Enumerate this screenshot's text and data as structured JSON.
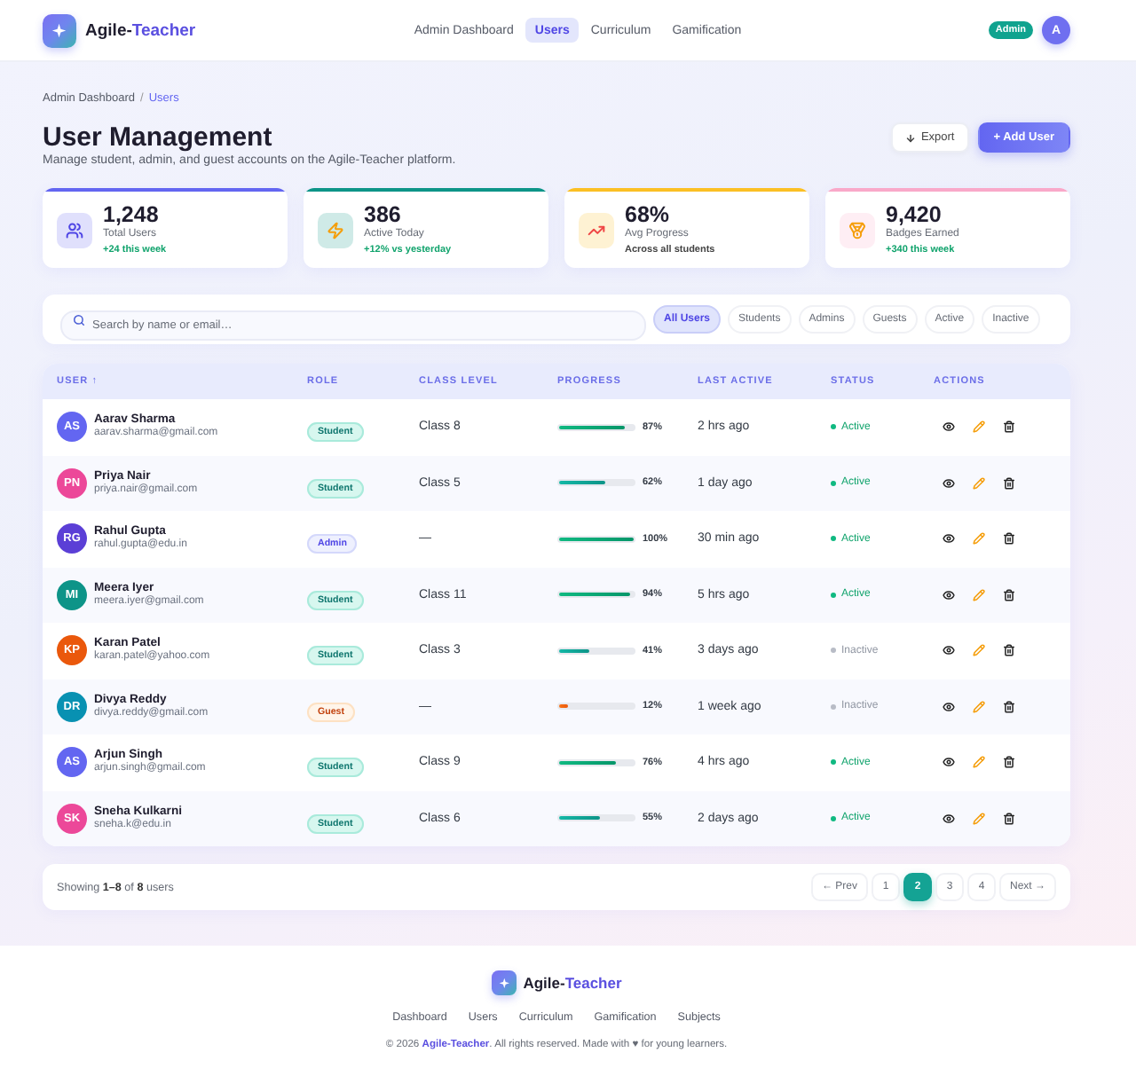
{
  "header": {
    "brand": {
      "prefix": "Agile-",
      "accent": "Teacher"
    },
    "nav": [
      {
        "label": "Admin Dashboard",
        "selected": false
      },
      {
        "label": "Users",
        "selected": true
      },
      {
        "label": "Curriculum",
        "selected": false
      },
      {
        "label": "Gamification",
        "selected": false
      }
    ],
    "role_badge": "Admin",
    "avatar": "A"
  },
  "breadcrumb": {
    "items": [
      {
        "label": "Admin Dashboard",
        "current": false
      },
      {
        "label": "Users",
        "current": true
      }
    ],
    "separator": "/"
  },
  "page": {
    "title": "User Management",
    "subtitle": "Manage student, admin, and guest accounts on the Agile-Teacher platform.",
    "actions": [
      {
        "label": "Export",
        "kind": "secondary"
      },
      {
        "label": "+ Add User",
        "kind": "primary"
      }
    ]
  },
  "stats": [
    {
      "kind": "users",
      "value": "1,248",
      "label": "Total Users",
      "note": "+24 this week",
      "positive": true,
      "color": "#6366f1"
    },
    {
      "kind": "activity",
      "value": "386",
      "label": "Active Today",
      "note": "+12% vs yesterday",
      "positive": true,
      "color": "#0d9488"
    },
    {
      "kind": "progress",
      "value": "68%",
      "label": "Avg Progress",
      "note": "Across all students",
      "positive": false,
      "color": "#fbbf24"
    },
    {
      "kind": "badges",
      "value": "9,420",
      "label": "Badges Earned",
      "note": "+340 this week",
      "positive": true,
      "color": "#f9a8c9"
    }
  ],
  "search": {
    "placeholder": "Search by name or email…"
  },
  "filters": [
    {
      "label": "All Users",
      "selected": true
    },
    {
      "label": "Students",
      "selected": false
    },
    {
      "label": "Admins",
      "selected": false
    },
    {
      "label": "Guests",
      "selected": false
    },
    {
      "label": "Active",
      "selected": false
    },
    {
      "label": "Inactive",
      "selected": false
    }
  ],
  "table": {
    "columns": [
      "USER ↑",
      "ROLE",
      "CLASS LEVEL",
      "PROGRESS",
      "LAST ACTIVE",
      "STATUS",
      "ACTIONS"
    ],
    "rows": [
      {
        "initials": "AS",
        "color": "#6366f1",
        "name": "Aarav Sharma",
        "email": "aarav.sharma@gmail.com",
        "role": {
          "label": "Student",
          "kind": "student"
        },
        "class_level": "Class 8",
        "progress": {
          "level": 0.87,
          "reading": "87%"
        },
        "last_active": "2 hrs ago",
        "status": {
          "label": "Active",
          "active": true
        }
      },
      {
        "initials": "PN",
        "color": "#ec4899",
        "name": "Priya Nair",
        "email": "priya.nair@gmail.com",
        "role": {
          "label": "Student",
          "kind": "student"
        },
        "class_level": "Class 5",
        "progress": {
          "level": 0.62,
          "reading": "62%"
        },
        "last_active": "1 day ago",
        "status": {
          "label": "Active",
          "active": true
        }
      },
      {
        "initials": "RG",
        "color": "#5b3fd6",
        "name": "Rahul Gupta",
        "email": "rahul.gupta@edu.in",
        "role": {
          "label": "Admin",
          "kind": "admin"
        },
        "class_level": "—",
        "progress": {
          "level": 1,
          "reading": "100%"
        },
        "last_active": "30 min ago",
        "status": {
          "label": "Active",
          "active": true
        }
      },
      {
        "initials": "MI",
        "color": "#0d9488",
        "name": "Meera Iyer",
        "email": "meera.iyer@gmail.com",
        "role": {
          "label": "Student",
          "kind": "student"
        },
        "class_level": "Class 11",
        "progress": {
          "level": 0.94,
          "reading": "94%"
        },
        "last_active": "5 hrs ago",
        "status": {
          "label": "Active",
          "active": true
        }
      },
      {
        "initials": "KP",
        "color": "#ea580c",
        "name": "Karan Patel",
        "email": "karan.patel@yahoo.com",
        "role": {
          "label": "Student",
          "kind": "student"
        },
        "class_level": "Class 3",
        "progress": {
          "level": 0.41,
          "reading": "41%"
        },
        "last_active": "3 days ago",
        "status": {
          "label": "Inactive",
          "active": false
        }
      },
      {
        "initials": "DR",
        "color": "#0891b2",
        "name": "Divya Reddy",
        "email": "divya.reddy@gmail.com",
        "role": {
          "label": "Guest",
          "kind": "guest"
        },
        "class_level": "—",
        "progress": {
          "level": 0.12,
          "reading": "12%"
        },
        "last_active": "1 week ago",
        "status": {
          "label": "Inactive",
          "active": false
        }
      },
      {
        "initials": "AS",
        "color": "#6366f1",
        "name": "Arjun Singh",
        "email": "arjun.singh@gmail.com",
        "role": {
          "label": "Student",
          "kind": "student"
        },
        "class_level": "Class 9",
        "progress": {
          "level": 0.76,
          "reading": "76%"
        },
        "last_active": "4 hrs ago",
        "status": {
          "label": "Active",
          "active": true
        }
      },
      {
        "initials": "SK",
        "color": "#ec4899",
        "name": "Sneha Kulkarni",
        "email": "sneha.k@edu.in",
        "role": {
          "label": "Student",
          "kind": "student"
        },
        "class_level": "Class 6",
        "progress": {
          "level": 0.55,
          "reading": "55%"
        },
        "last_active": "2 days ago",
        "status": {
          "label": "Active",
          "active": true
        }
      }
    ]
  },
  "pagination": {
    "summary": "Showing **1–8** of **8** users",
    "prev": "← Prev",
    "pages": [
      {
        "label": "1",
        "selected": false
      },
      {
        "label": "2",
        "selected": true
      },
      {
        "label": "3",
        "selected": false
      },
      {
        "label": "4",
        "selected": false
      }
    ],
    "next": "Next →"
  },
  "footer": {
    "brand": {
      "prefix": "Agile-",
      "accent": "Teacher"
    },
    "links": [
      "Dashboard",
      "Users",
      "Curriculum",
      "Gamification",
      "Subjects"
    ],
    "copyright": "© 2026 **Agile-Teacher**. All rights reserved. Made with ♥ for young learners."
  }
}
